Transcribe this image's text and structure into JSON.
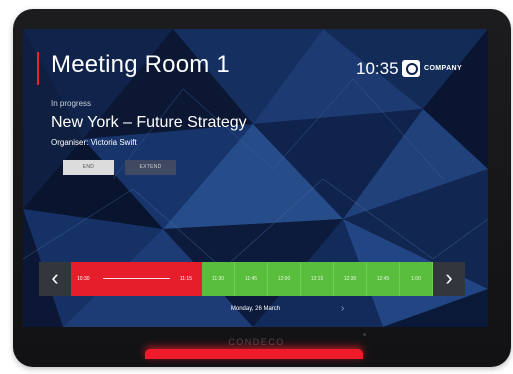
{
  "device": {
    "brand": "CONDECO",
    "led_color": "#ee1c2b"
  },
  "screen": {
    "room_name": "Meeting Room 1",
    "clock": "10:35",
    "company": "COMPANY",
    "status": "In progress",
    "meeting_title": "New York – Future Strategy",
    "organiser": "Organiser: Victoria Swift",
    "buttons": {
      "end": "END",
      "extend": "EXTEND"
    },
    "timeline": {
      "booking_start": "10:30",
      "booking_end": "11:15",
      "free_slots": [
        "11:30",
        "11:45",
        "12:00",
        "12:15",
        "12:30",
        "12:45",
        "1:00"
      ],
      "prev_icon": "‹",
      "next_icon": "›"
    },
    "date": "Monday, 26 March",
    "date_next_icon": "›"
  },
  "colors": {
    "booked": "#e61d2a",
    "free": "#58be3c",
    "accent": "#e8222e"
  }
}
